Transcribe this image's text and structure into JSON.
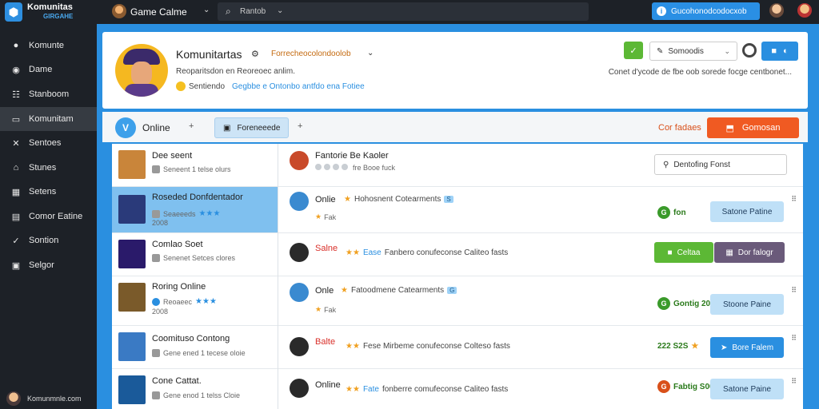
{
  "topbar": {
    "brand": "Komunitas",
    "brand_sub": "GIRGAHE",
    "game_title": "Game  Calme",
    "search_label": "Rantob",
    "action_button": "Gucohonodcodocxob",
    "info_glyph": "i"
  },
  "sidebar": {
    "items": [
      {
        "label": "Komunte",
        "icon": "circle-icon"
      },
      {
        "label": "Dame",
        "icon": "gamepad-icon"
      },
      {
        "label": "Stanboom",
        "icon": "people-icon"
      },
      {
        "label": "Komunitam",
        "icon": "community-icon"
      },
      {
        "label": "Sentoes",
        "icon": "tools-icon"
      },
      {
        "label": "Stunes",
        "icon": "home-icon"
      },
      {
        "label": "Setens",
        "icon": "grid-icon"
      },
      {
        "label": "Comor Eatine",
        "icon": "chat-icon"
      },
      {
        "label": "Sontion",
        "icon": "check-icon"
      },
      {
        "label": "Selgor",
        "icon": "doc-icon"
      }
    ],
    "footer_user": "Komunmnle.com"
  },
  "profile": {
    "name": "Komunitartas",
    "subtitle": "Forrecheocolondoolob",
    "description": "Reoparitsdon en Reoreoec anlim.",
    "status_label": "Sentiendo",
    "status_link": "Gegbbe e Ontonbo antfdo ena Fotiee",
    "edit_button": "Somoodis",
    "right_text": "Conet d'ycode de fbe oob sorede focge centbonet..."
  },
  "filters": {
    "online_glyph": "V",
    "online_label": "Online",
    "plus": "+",
    "tab_label": "Foreneeede",
    "contacts_label": "Cor fadaes",
    "connect_button": "Gomosan"
  },
  "games": [
    {
      "title": "Dee seent",
      "sub": "Seneent 1 telse olurs",
      "color": "#c9853a"
    },
    {
      "title": "Roseded Donfdentador",
      "sub": "Seaeeeds",
      "sub2": "2008",
      "stars": "★★★",
      "color": "#2a3a7a",
      "active": true
    },
    {
      "title": "Comlao Soet",
      "sub": "Senenet Setces clores",
      "color": "#2a1a6a"
    },
    {
      "title": "Roring Online",
      "sub": "Reoaeec",
      "sub2": "2008",
      "stars": "★★★",
      "color": "#7a5a2a"
    },
    {
      "title": "Coomituso Contong",
      "sub": "Gene ened 1 tecese oloie",
      "color": "#3a7ac4"
    },
    {
      "title": "Cone Cattat.",
      "sub": "Gene enod 1 telss Cloie",
      "color": "#1a5a9a"
    }
  ],
  "rows": [
    {
      "name": "Fantorie Be Kaoler",
      "sub": "fre Booe fuck",
      "button": "Dentofing Fonst",
      "btn_style": "outline",
      "av": "#c94a2a"
    },
    {
      "name": "Onlie",
      "badge": "Hohosnent Cotearments",
      "tag": "S",
      "sub": "Fak",
      "button": "Satone Patine",
      "btn_style": "light",
      "online": "fon",
      "av": "#3a8ad0"
    },
    {
      "name": "Salne",
      "badge": "Fanbero conufeconse Caliteo fasts",
      "tag": "Ease",
      "red": true,
      "button": "Celtaa",
      "btn_style": "green",
      "button2": "Dor falogr",
      "av": "#2a2a2a"
    },
    {
      "name": "Onle",
      "badge": "Fatoodmene Catearments",
      "tag": "G",
      "sub": "Fak",
      "button": "Stoone Paine",
      "btn_style": "light",
      "online": "Gontig 2008",
      "av": "#3a8ad0"
    },
    {
      "name": "Balte",
      "badge": "Fese Mirbeme conufeconse Colteso fasts",
      "red": true,
      "button": "Bore Falem",
      "btn_style": "blue",
      "online": "222 S2S",
      "av": "#2a2a2a"
    },
    {
      "name": "Online",
      "badge": "fonberre comufeconse Caliteo fasts",
      "tag": "Fate",
      "button": "Satone Paine",
      "btn_style": "light",
      "online": "Fabtig S00",
      "av": "#2a2a2a"
    }
  ]
}
